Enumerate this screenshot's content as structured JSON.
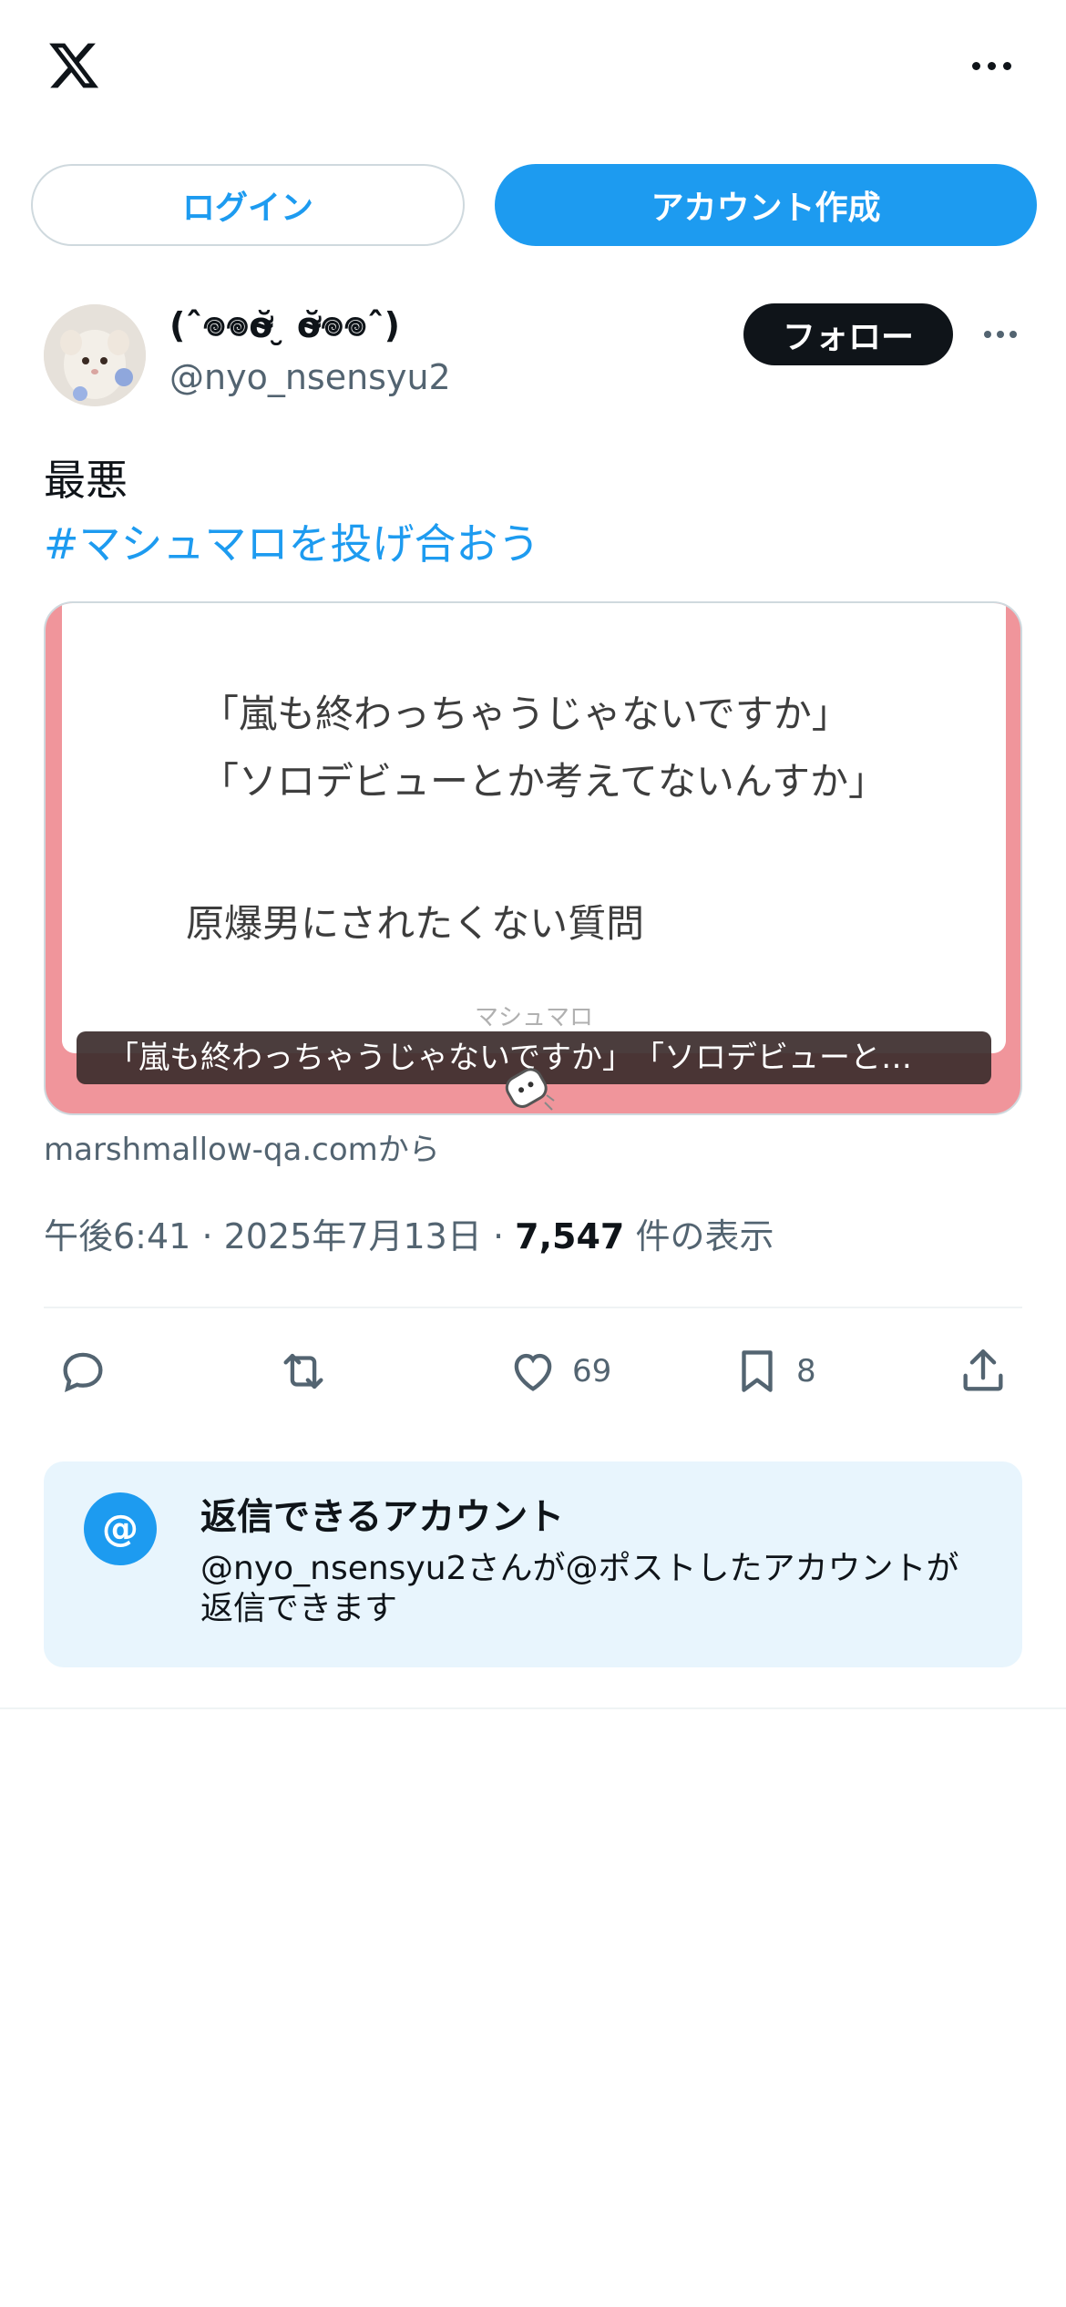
{
  "header": {
    "logo_icon": "x-logo-icon",
    "more_icon": "more-horizontal-icon"
  },
  "auth": {
    "login_label": "ログイン",
    "signup_label": "アカウント作成"
  },
  "post": {
    "author": {
      "display_name": "(ˆ𖦹𖦹ơ̴̴̆ ̮ ơ̴̴̆𖦹𖦹ˆ)",
      "handle": "@nyo_nsensyu2",
      "avatar_icon": "avatar-image"
    },
    "follow_label": "フォロー",
    "text_line": "最悪",
    "hashtag": "#マシュマロを投げ合おう",
    "card": {
      "lines": [
        "「嵐も終わっちゃうじゃないですか」",
        "「ソロデビューとか考えてないんすか」",
        "原爆男にされたくない質問"
      ],
      "brand": "マシュマロ",
      "overlay_title": "「嵐も終わっちゃうじゃないですか」　「ソロデビューと…",
      "source": "marshmallow-qa.comから"
    },
    "meta": {
      "time": "午後6:41",
      "separator": "·",
      "date": "2025年7月13日",
      "views_count": "7,547",
      "views_label": "件の表示"
    },
    "actions": {
      "reply_icon": "reply-icon",
      "repost_icon": "repost-icon",
      "like_icon": "heart-icon",
      "like_count": "69",
      "bookmark_icon": "bookmark-icon",
      "bookmark_count": "8",
      "share_icon": "share-icon"
    }
  },
  "reply_restriction": {
    "icon_text": "@",
    "title": "返信できるアカウント",
    "description": "@nyo_nsensyu2さんが@ポストしたアカウントが返信できます"
  },
  "colors": {
    "accent": "#1d9bf0",
    "text": "#0f1419",
    "muted": "#536471",
    "card_border": "#f0959b",
    "reply_bg": "#e8f5fd"
  }
}
